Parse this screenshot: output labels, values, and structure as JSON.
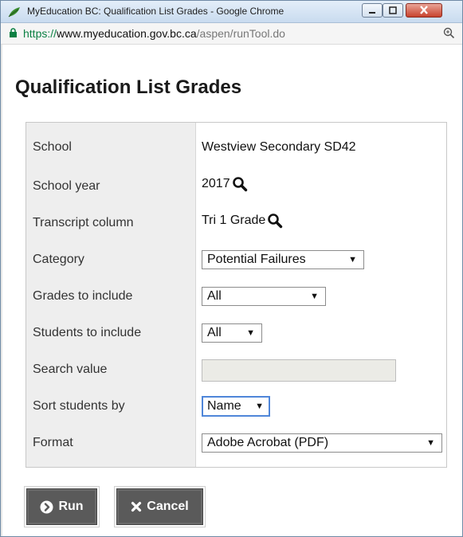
{
  "window": {
    "title": "MyEducation BC: Qualification List Grades - Google Chrome"
  },
  "address": {
    "scheme": "https://",
    "host": "www.myeducation.gov.bc.ca",
    "path": "/aspen/runTool.do"
  },
  "page": {
    "title": "Qualification List Grades"
  },
  "form": {
    "school": {
      "label": "School",
      "value": "Westview Secondary SD42"
    },
    "school_year": {
      "label": "School year",
      "value": "2017"
    },
    "transcript_column": {
      "label": "Transcript column",
      "value": "Tri 1 Grade"
    },
    "category": {
      "label": "Category",
      "selected": "Potential Failures"
    },
    "grades": {
      "label": "Grades to include",
      "selected": "All"
    },
    "students": {
      "label": "Students to include",
      "selected": "All"
    },
    "search": {
      "label": "Search value",
      "value": ""
    },
    "sort": {
      "label": "Sort students by",
      "selected": "Name"
    },
    "format": {
      "label": "Format",
      "selected": "Adobe Acrobat (PDF)"
    }
  },
  "actions": {
    "run_label": "Run",
    "cancel_label": "Cancel"
  },
  "colors": {
    "button_bg": "#5a5a5a",
    "label_column_bg": "#eeeeee",
    "focus_border": "#4f86d9",
    "lock_green": "#0b8043"
  },
  "icons": {
    "app": "myeducation-leaf-icon",
    "lock": "lock-icon",
    "zoom": "zoom-icon",
    "lookup": "magnifier-icon",
    "run": "circle-arrow-right-icon",
    "cancel": "x-icon"
  }
}
